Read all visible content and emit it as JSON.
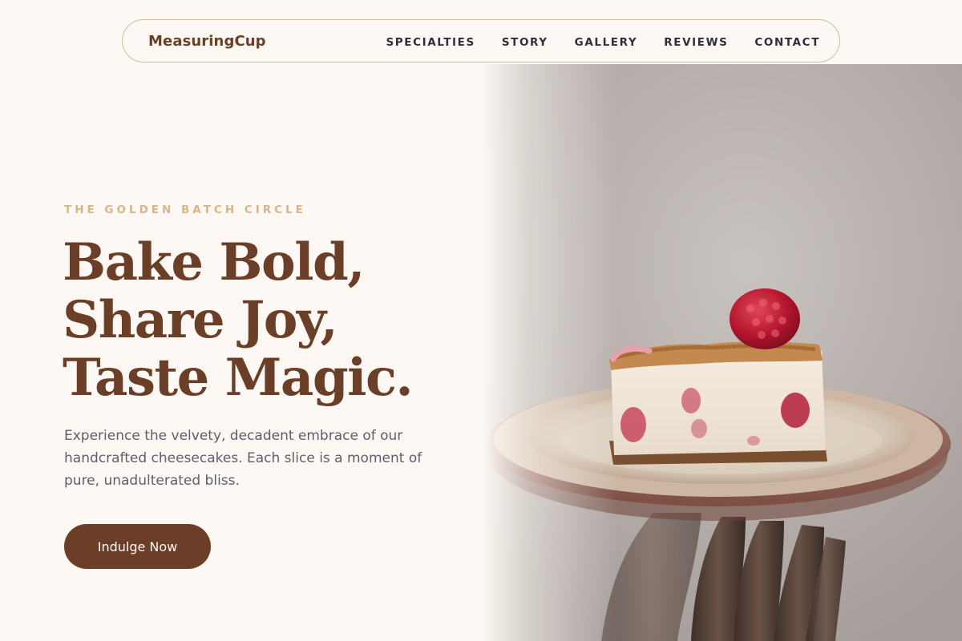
{
  "nav": {
    "brand": "MeasuringCup",
    "links": [
      "SPECIALTIES",
      "STORY",
      "GALLERY",
      "REVIEWS",
      "CONTACT"
    ]
  },
  "hero": {
    "eyebrow": "THE GOLDEN BATCH CIRCLE",
    "headline": [
      "Bake Bold,",
      "Share Joy,",
      "Taste Magic."
    ],
    "description": "Experience the velvety, decadent embrace of our handcrafted cheesecakes. Each slice is a moment of pure, unadulterated bliss.",
    "cta_label": "Indulge Now",
    "image_subject": "hand holding a plate with a slice of raspberry cheesecake"
  },
  "colors": {
    "background": "#fdf8f3",
    "brand_brown": "#6b3f27",
    "eyebrow_gold": "#d4b68c",
    "nav_border": "#cdbf97",
    "nav_text": "#2c2f3a",
    "body_text": "#5b5f6b"
  }
}
